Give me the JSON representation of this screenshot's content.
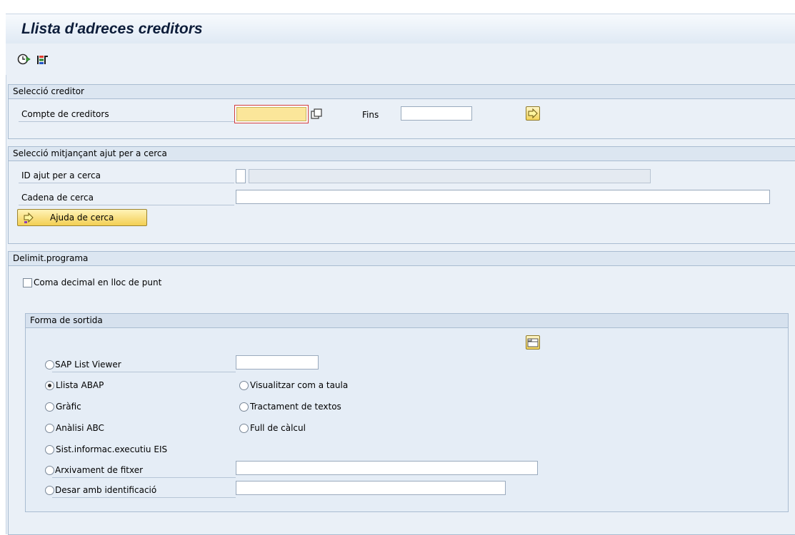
{
  "window": {
    "title": "Llista d'adreces creditors"
  },
  "toolbar": {
    "execute_icon": "execute-clock-icon",
    "selection_icon": "multiple-selection-icon"
  },
  "group_creditor": {
    "header": "Selecció creditor",
    "account_label": "Compte de creditors",
    "account_value": "",
    "to_label": "Fins",
    "to_value": ""
  },
  "group_search": {
    "header": "Selecció mitjançant ajut per a cerca",
    "id_label": "ID ajut per a cerca",
    "id_value": "",
    "id_desc": "",
    "string_label": "Cadena de cerca",
    "string_value": "",
    "button_label": "Ajuda de cerca"
  },
  "group_program": {
    "header": "Delimit.programa",
    "decimal_label": "Coma decimal en lloc de punt",
    "decimal_checked": false
  },
  "output": {
    "header": "Forma de sortida",
    "options": {
      "alv": "SAP List Viewer",
      "abap": "Llista ABAP",
      "table": "Visualitzar com a taula",
      "graphic": "Gràfic",
      "text": "Tractament de textos",
      "abc": "Anàlisi ABC",
      "spreadsheet": "Full de càlcul",
      "eis": "Sist.informac.executiu EIS",
      "archive": "Arxivament de fitxer",
      "save": "Desar amb identificació"
    },
    "selected": "abap",
    "alv_value": "",
    "archive_value": "",
    "save_value": ""
  },
  "colors": {
    "background": "#eaf0f7",
    "focus_field": "#fbe69a",
    "button": "#f3cf53"
  }
}
